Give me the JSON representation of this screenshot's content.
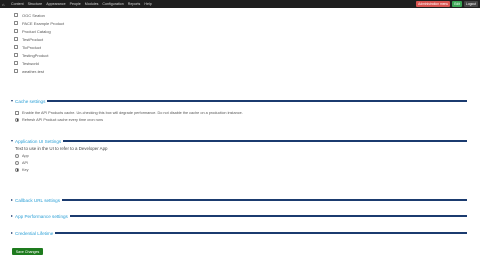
{
  "toolbar": {
    "menu": [
      "Content",
      "Structure",
      "Appearance",
      "People",
      "Modules",
      "Configuration",
      "Reports",
      "Help"
    ],
    "right": [
      "Administration menu",
      "Edit",
      "Logout"
    ]
  },
  "products": [
    "OGC Seaton",
    "PACE Example Product",
    "Product Catalog",
    "TestProduct",
    "TicProduct",
    "TestingProduct",
    "Testworld",
    "weather-test"
  ],
  "cache": {
    "title": "Cache settings",
    "options": [
      "Enable the API Products cache. Un-checking this box will degrade performance. Do not disable the cache on a production instance.",
      "Refresh API Product cache every time cron runs"
    ]
  },
  "app_ui": {
    "title": "Application UI Settings",
    "description": "Text to use in the UI to refer to a Developer App",
    "options": [
      "App",
      "API",
      "Key"
    ],
    "selected": "Key"
  },
  "collapsed": [
    "Callback URL settings",
    "App Performance settings",
    "Credential Lifetime"
  ],
  "save_label": "Save Changes"
}
